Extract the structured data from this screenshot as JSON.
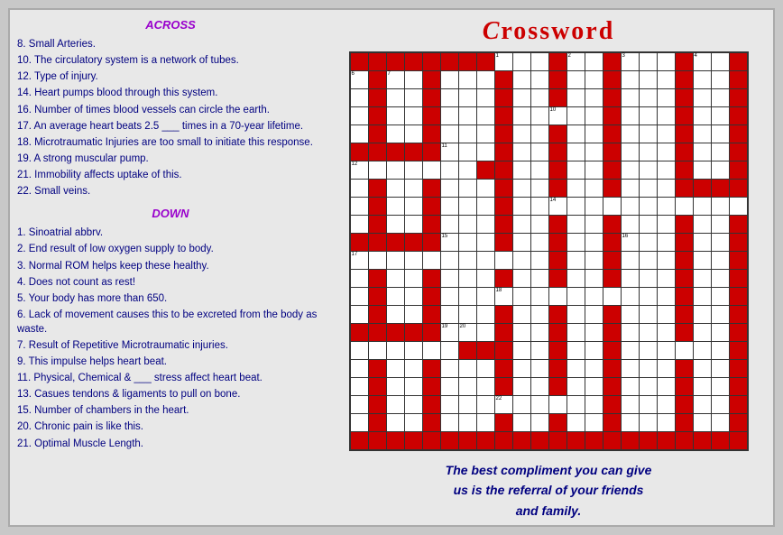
{
  "title": "Crossword",
  "across_label": "ACROSS",
  "down_label": "DOWN",
  "across_clues": [
    "8. Small Arteries.",
    "10. The circulatory system is a network of tubes.",
    "12. Type of injury.",
    "14. Heart pumps blood through this system.",
    "16. Number of times blood vessels can circle the earth.",
    "17. An average heart beats 2.5 ___ times in a 70-year lifetime.",
    "18. Microtraumatic Injuries are too small to initiate this response.",
    "19. A strong muscular pump.",
    "21. Immobility affects uptake of this.",
    "22. Small veins."
  ],
  "down_clues": [
    "1. Sinoatrial abbrv.",
    "2. End result of low oxygen supply to body.",
    "3. Normal ROM helps keep these healthy.",
    "4. Does not count as rest!",
    "5. Your body has more than 650.",
    "6. Lack of movement causes this to be excreted from the body as waste.",
    "7. Result of Repetitive Microtraumatic injuries.",
    "9. This impulse helps heart beat.",
    "11. Physical, Chemical & ___ stress affect heart beat.",
    "13. Casues tendons & ligaments to pull on bone.",
    "15. Number of chambers in the heart.",
    "20. Chronic pain is like this.",
    "21. Optimal Muscle Length."
  ],
  "tagline": "The best compliment you can give us is the referral of your friends and family."
}
